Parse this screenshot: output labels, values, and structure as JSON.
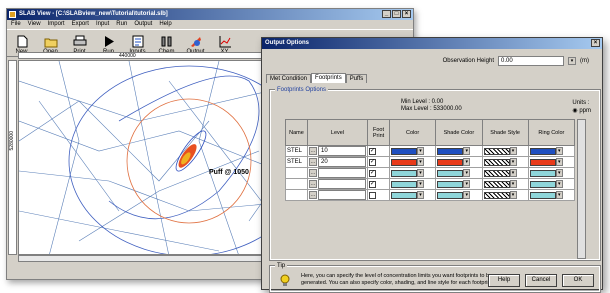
{
  "main_window": {
    "title": "SLAB View - [C:\\SLABview_new\\Tutorial\\tutorial.slb]",
    "menu": [
      "File",
      "View",
      "Import",
      "Export",
      "Input",
      "Run",
      "Output",
      "Help"
    ],
    "toolbar": [
      {
        "label": "New",
        "icon": "new-file-icon"
      },
      {
        "label": "Open",
        "icon": "open-folder-icon"
      },
      {
        "label": "Print",
        "icon": "printer-icon"
      },
      {
        "label": "Run",
        "icon": "play-icon"
      },
      {
        "label": "Inputs",
        "icon": "inputs-icon"
      },
      {
        "label": "Chem",
        "icon": "chem-icon"
      },
      {
        "label": "Output",
        "icon": "output-icon"
      },
      {
        "label": "XY",
        "icon": "xy-icon"
      }
    ],
    "ruler_x": "440000",
    "ruler_y": "5280000",
    "map_label": "Puff @ 1050",
    "window_buttons": [
      "_",
      "□",
      "×"
    ]
  },
  "dialog": {
    "title": "Output Options",
    "close": "×",
    "obs_label": "Observation Height",
    "obs_value": "0.00",
    "obs_unit": "(m)",
    "tabs": [
      "Met Condition",
      "Footprints",
      "Puffs"
    ],
    "group_label": "Footprints Options",
    "min_level": "Min Level : 0.00",
    "max_level": "Max Level : 533000.00",
    "units_label": "Units :",
    "units_value": "ppm",
    "columns": [
      "Name",
      "Level",
      "Foot Print",
      "Color",
      "Shade Color",
      "Shade Style",
      "Ring Color"
    ],
    "rows": [
      {
        "name": "STEL",
        "level": "10",
        "fp": "✓",
        "color": "#1e4fc0",
        "shade": "#1e4fc0",
        "style": "hatch",
        "ring": "#1e4fc0"
      },
      {
        "name": "STEL",
        "level": "20",
        "fp": "✓",
        "color": "#e83a1a",
        "shade": "#e83a1a",
        "style": "hatch",
        "ring": "#e83a1a"
      },
      {
        "name": "",
        "level": "",
        "fp": "✓",
        "color": "#8fd6da",
        "shade": "#8fd6da",
        "style": "hatch",
        "ring": "#8fd6da"
      },
      {
        "name": "",
        "level": "",
        "fp": "✓",
        "color": "#8fd6da",
        "shade": "#8fd6da",
        "style": "hatch",
        "ring": "#8fd6da"
      },
      {
        "name": "",
        "level": "",
        "fp": "",
        "color": "#8fd6da",
        "shade": "#8fd6da",
        "style": "hatch",
        "ring": "#8fd6da"
      }
    ],
    "tip_label": "Tip",
    "tip_text": "Here, you can specify the level of concentration limits you want footprints to be generated. You can also specify color, shading, and line style for each footprint.",
    "buttons": [
      "Help",
      "Cancel",
      "OK"
    ]
  }
}
